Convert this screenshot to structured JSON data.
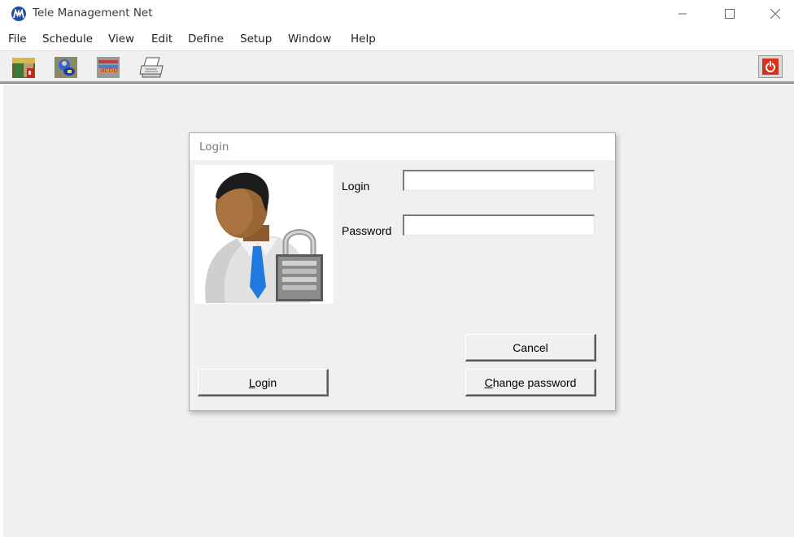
{
  "window": {
    "title": "Tele Management Net"
  },
  "menu": [
    "File",
    "Schedule",
    "View",
    "Edit",
    "Define",
    "Setup",
    "Window",
    "Help"
  ],
  "toolbar": {
    "icons": [
      "exit-door-icon",
      "user-key-icon",
      "action-icon",
      "printer-icon",
      "power-icon"
    ]
  },
  "dialog": {
    "title": "Login",
    "login_label": "Login",
    "password_label": "Password",
    "login_value": "",
    "password_value": "",
    "buttons": {
      "login": {
        "mnemonic": "L",
        "rest": "ogin"
      },
      "cancel": "Cancel",
      "change_password": {
        "mnemonic": "C",
        "rest": "hange password"
      }
    }
  },
  "colors": {
    "logo": "#1f4e9a",
    "power": "#d9301c",
    "client_bg": "#f0f0f0"
  }
}
